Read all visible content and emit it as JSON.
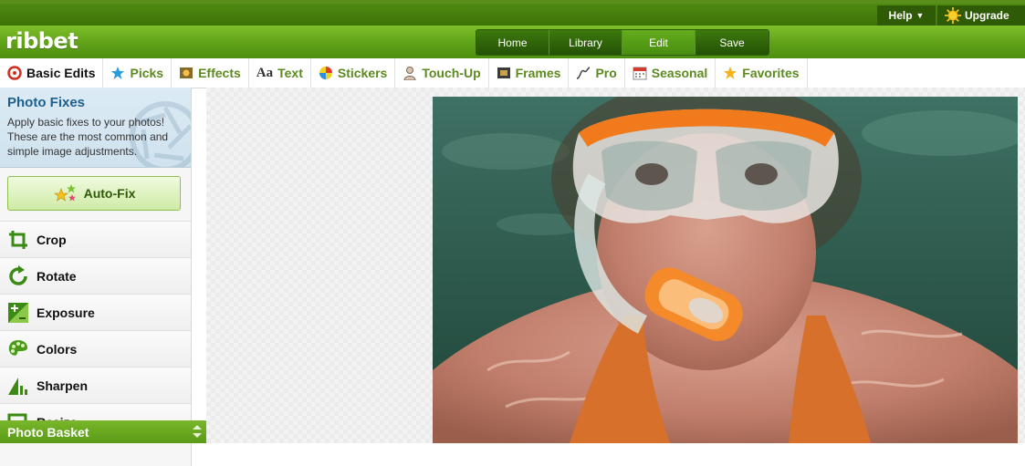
{
  "app": {
    "logo": "ribbet"
  },
  "topbar": {
    "help_label": "Help",
    "upgrade_label": "Upgrade"
  },
  "nav": {
    "tabs": [
      {
        "label": "Home"
      },
      {
        "label": "Library"
      },
      {
        "label": "Edit",
        "active": true
      },
      {
        "label": "Save"
      }
    ]
  },
  "tooltabs": [
    {
      "label": "Basic Edits",
      "icon": "basic-edits-icon",
      "active": true
    },
    {
      "label": "Picks",
      "icon": "star-icon"
    },
    {
      "label": "Effects",
      "icon": "effects-icon"
    },
    {
      "label": "Text",
      "icon_text": "Aa"
    },
    {
      "label": "Stickers",
      "icon": "beach-ball-icon"
    },
    {
      "label": "Touch-Up",
      "icon": "person-icon"
    },
    {
      "label": "Frames",
      "icon": "frame-icon"
    },
    {
      "label": "Pro",
      "icon": "curve-icon"
    },
    {
      "label": "Seasonal",
      "icon": "calendar-icon"
    },
    {
      "label": "Favorites",
      "icon": "star-icon"
    }
  ],
  "panel": {
    "title": "Photo Fixes",
    "description": "Apply basic fixes to your photos! These are the most common and simple image adjustments.",
    "autofix_label": "Auto-Fix",
    "tools": [
      {
        "label": "Crop",
        "icon": "crop-icon"
      },
      {
        "label": "Rotate",
        "icon": "rotate-icon"
      },
      {
        "label": "Exposure",
        "icon": "exposure-icon"
      },
      {
        "label": "Colors",
        "icon": "palette-icon"
      },
      {
        "label": "Sharpen",
        "icon": "sharpen-icon"
      },
      {
        "label": "Resize",
        "icon": "resize-icon"
      }
    ]
  },
  "basket": {
    "label": "Photo Basket"
  },
  "colors": {
    "brand_green": "#5fa218",
    "tab_text": "#5d8a1f",
    "info_title": "#1c5f8f"
  }
}
